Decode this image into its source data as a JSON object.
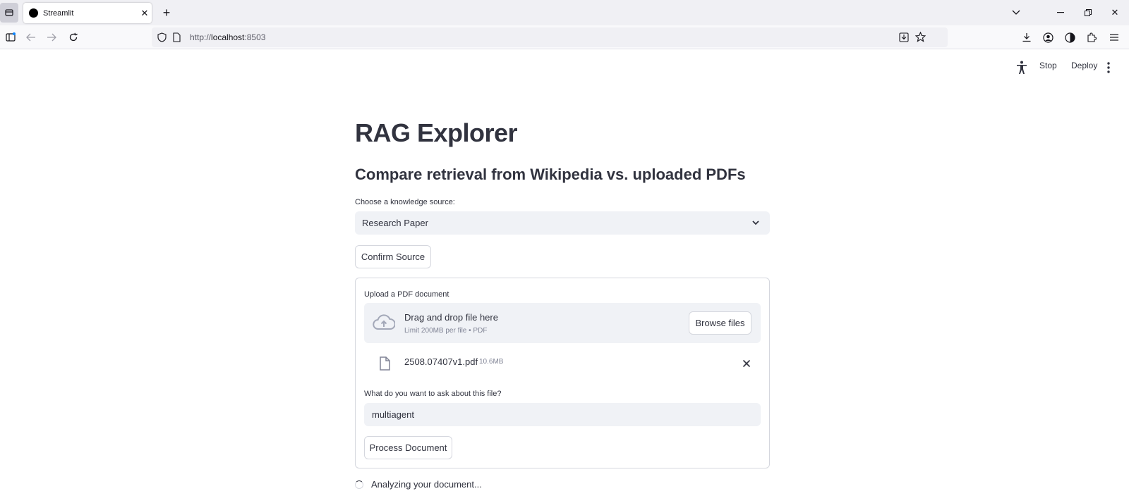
{
  "browser": {
    "tab_title": "Streamlit",
    "url_prefix": "http://",
    "url_host": "localhost",
    "url_port": ":8503"
  },
  "header": {
    "stop_label": "Stop",
    "deploy_label": "Deploy"
  },
  "page": {
    "title": "RAG Explorer",
    "subtitle": "Compare retrieval from Wikipedia vs. uploaded PDFs"
  },
  "source_select": {
    "label": "Choose a knowledge source:",
    "value": "Research Paper"
  },
  "confirm_button": "Confirm Source",
  "uploader": {
    "label": "Upload a PDF document",
    "drop_text": "Drag and drop file here",
    "limit_text": "Limit 200MB per file • PDF",
    "browse_label": "Browse files",
    "file_name": "2508.07407v1.pdf",
    "file_size": "10.6MB"
  },
  "question": {
    "label": "What do you want to ask about this file?",
    "value": "multiagent"
  },
  "process_button": "Process Document",
  "status_text": "Analyzing your document...",
  "colors": {
    "text": "#31333f",
    "input_bg": "#f0f2f6",
    "border": "#d5d7de",
    "muted": "#808495"
  }
}
